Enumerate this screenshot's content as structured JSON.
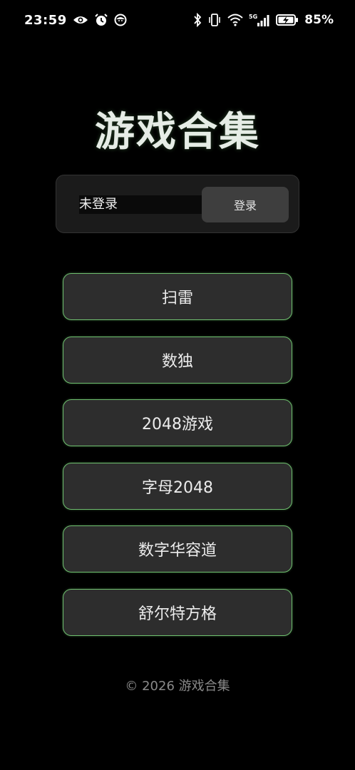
{
  "status_bar": {
    "time": "23:59",
    "left_icons": [
      "eye-icon",
      "alarm-clock-icon",
      "face-icon"
    ],
    "right_icons": [
      "bluetooth-icon",
      "vibrate-icon",
      "wifi-icon",
      "5g-signal-icon",
      "battery-charging-icon"
    ],
    "network_label": "5G",
    "battery_percent": "85%"
  },
  "page": {
    "title": "游戏合集"
  },
  "login": {
    "status_text": "未登录",
    "button_label": "登录"
  },
  "games": [
    {
      "label": "扫雷"
    },
    {
      "label": "数独"
    },
    {
      "label": "2048游戏"
    },
    {
      "label": "字母2048"
    },
    {
      "label": "数字华容道"
    },
    {
      "label": "舒尔特方格"
    }
  ],
  "footer": {
    "text": "© 2026 游戏合集"
  },
  "colors": {
    "background": "#000000",
    "accent_border": "#6fbf6f",
    "button_fill": "#2d2d2d",
    "card_fill": "#1b1b1b"
  }
}
